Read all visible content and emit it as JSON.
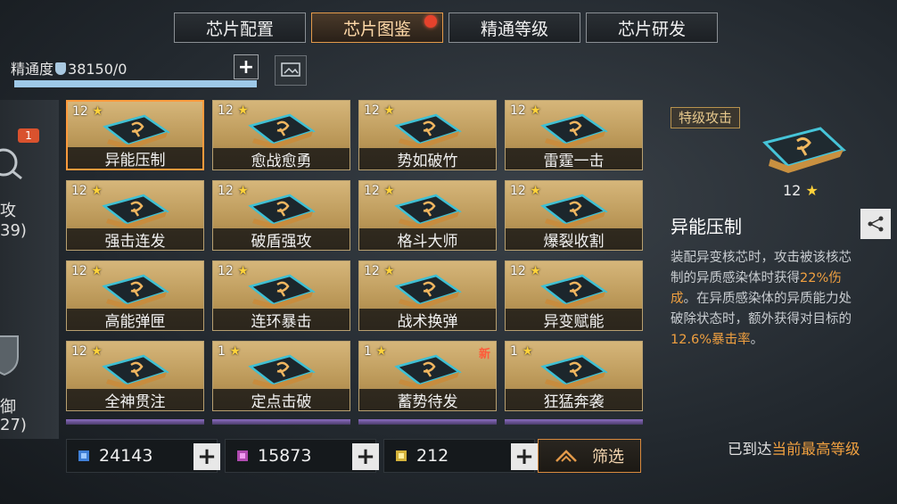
{
  "tabs": [
    {
      "label": "芯片配置",
      "active": false
    },
    {
      "label": "芯片图鉴",
      "active": true,
      "has_dot": true
    },
    {
      "label": "精通等级",
      "active": false
    },
    {
      "label": "芯片研发",
      "active": false
    }
  ],
  "mastery": {
    "label": "精通度",
    "value": "38150/0",
    "progress_fraction": 1.0
  },
  "side": {
    "badge": "1",
    "text_top": "攻",
    "text_top_sub": "39)",
    "text_bottom": "御",
    "text_bottom_sub": "27)"
  },
  "chips": [
    {
      "level": "12",
      "name": "异能压制",
      "selected": true
    },
    {
      "level": "12",
      "name": "愈战愈勇"
    },
    {
      "level": "12",
      "name": "势如破竹"
    },
    {
      "level": "12",
      "name": "雷霆一击"
    },
    {
      "level": "12",
      "name": "强击连发"
    },
    {
      "level": "12",
      "name": "破盾强攻"
    },
    {
      "level": "12",
      "name": "格斗大师"
    },
    {
      "level": "12",
      "name": "爆裂收割"
    },
    {
      "level": "12",
      "name": "高能弹匣"
    },
    {
      "level": "12",
      "name": "连环暴击"
    },
    {
      "level": "12",
      "name": "战术换弹"
    },
    {
      "level": "12",
      "name": "异变赋能"
    },
    {
      "level": "12",
      "name": "全神贯注"
    },
    {
      "level": "1",
      "name": "定点击破"
    },
    {
      "level": "1",
      "name": "蓄势待发",
      "new": "新"
    },
    {
      "level": "1",
      "name": "狂猛奔袭"
    }
  ],
  "resources": [
    {
      "value": "24143",
      "color": "#3f7fd6"
    },
    {
      "value": "15873",
      "color": "#b04ab0"
    },
    {
      "value": "212",
      "color": "#d4b23a"
    }
  ],
  "filter_label": "筛选",
  "detail": {
    "tag": "特级攻击",
    "level": "12",
    "name": "异能压制",
    "desc_lines": [
      {
        "text": "装配异变核芯时，攻击被该核芯",
        "hl": ""
      },
      {
        "text": "制的异质感染体时获得",
        "hl": "22%伤"
      },
      {
        "text": "",
        "hl": "成",
        "after": "。在异质感染体的异质能力处"
      },
      {
        "text": "破除状态时，额外获得对目标的",
        "hl": ""
      },
      {
        "text": "",
        "hl": "12.6%暴击率",
        "after": "。"
      }
    ]
  },
  "max_level": {
    "prefix": "已到达",
    "highlight": "当前最高等级"
  }
}
